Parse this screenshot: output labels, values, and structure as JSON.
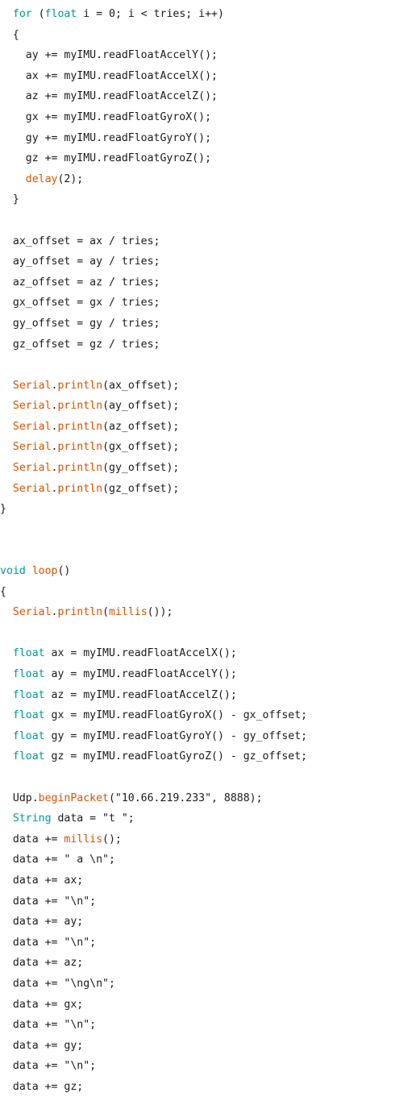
{
  "colors": {
    "background": "#ffffff",
    "text": "#1b1b1b",
    "keyword": "#00979c",
    "function": "#d35400"
  },
  "code": {
    "language": "Arduino C++",
    "lines": [
      [
        {
          "t": "  "
        },
        {
          "t": "for",
          "c": "kw"
        },
        {
          "t": " ("
        },
        {
          "t": "float",
          "c": "kw"
        },
        {
          "t": " i = 0; i < tries; i++)"
        }
      ],
      [
        {
          "t": "  {"
        }
      ],
      [
        {
          "t": "    ay += myIMU.readFloatAccelY();"
        }
      ],
      [
        {
          "t": "    ax += myIMU.readFloatAccelX();"
        }
      ],
      [
        {
          "t": "    az += myIMU.readFloatAccelZ();"
        }
      ],
      [
        {
          "t": "    gx += myIMU.readFloatGyroX();"
        }
      ],
      [
        {
          "t": "    gy += myIMU.readFloatGyroY();"
        }
      ],
      [
        {
          "t": "    gz += myIMU.readFloatGyroZ();"
        }
      ],
      [
        {
          "t": "    "
        },
        {
          "t": "delay",
          "c": "fn"
        },
        {
          "t": "(2);"
        }
      ],
      [
        {
          "t": "  }"
        }
      ],
      [
        {
          "t": ""
        }
      ],
      [
        {
          "t": "  ax_offset = ax / tries;"
        }
      ],
      [
        {
          "t": "  ay_offset = ay / tries;"
        }
      ],
      [
        {
          "t": "  az_offset = az / tries;"
        }
      ],
      [
        {
          "t": "  gx_offset = gx / tries;"
        }
      ],
      [
        {
          "t": "  gy_offset = gy / tries;"
        }
      ],
      [
        {
          "t": "  gz_offset = gz / tries;"
        }
      ],
      [
        {
          "t": ""
        }
      ],
      [
        {
          "t": "  "
        },
        {
          "t": "Serial",
          "c": "fn"
        },
        {
          "t": "."
        },
        {
          "t": "println",
          "c": "fn"
        },
        {
          "t": "(ax_offset);"
        }
      ],
      [
        {
          "t": "  "
        },
        {
          "t": "Serial",
          "c": "fn"
        },
        {
          "t": "."
        },
        {
          "t": "println",
          "c": "fn"
        },
        {
          "t": "(ay_offset);"
        }
      ],
      [
        {
          "t": "  "
        },
        {
          "t": "Serial",
          "c": "fn"
        },
        {
          "t": "."
        },
        {
          "t": "println",
          "c": "fn"
        },
        {
          "t": "(az_offset);"
        }
      ],
      [
        {
          "t": "  "
        },
        {
          "t": "Serial",
          "c": "fn"
        },
        {
          "t": "."
        },
        {
          "t": "println",
          "c": "fn"
        },
        {
          "t": "(gx_offset);"
        }
      ],
      [
        {
          "t": "  "
        },
        {
          "t": "Serial",
          "c": "fn"
        },
        {
          "t": "."
        },
        {
          "t": "println",
          "c": "fn"
        },
        {
          "t": "(gy_offset);"
        }
      ],
      [
        {
          "t": "  "
        },
        {
          "t": "Serial",
          "c": "fn"
        },
        {
          "t": "."
        },
        {
          "t": "println",
          "c": "fn"
        },
        {
          "t": "(gz_offset);"
        }
      ],
      [
        {
          "t": "}"
        }
      ],
      [
        {
          "t": ""
        }
      ],
      [
        {
          "t": ""
        }
      ],
      [
        {
          "t": "void",
          "c": "kw"
        },
        {
          "t": " "
        },
        {
          "t": "loop",
          "c": "fn"
        },
        {
          "t": "()"
        }
      ],
      [
        {
          "t": "{"
        }
      ],
      [
        {
          "t": "  "
        },
        {
          "t": "Serial",
          "c": "fn"
        },
        {
          "t": "."
        },
        {
          "t": "println",
          "c": "fn"
        },
        {
          "t": "("
        },
        {
          "t": "millis",
          "c": "fn"
        },
        {
          "t": "());"
        }
      ],
      [
        {
          "t": ""
        }
      ],
      [
        {
          "t": "  "
        },
        {
          "t": "float",
          "c": "kw"
        },
        {
          "t": " ax = myIMU.readFloatAccelX();"
        }
      ],
      [
        {
          "t": "  "
        },
        {
          "t": "float",
          "c": "kw"
        },
        {
          "t": " ay = myIMU.readFloatAccelY();"
        }
      ],
      [
        {
          "t": "  "
        },
        {
          "t": "float",
          "c": "kw"
        },
        {
          "t": " az = myIMU.readFloatAccelZ();"
        }
      ],
      [
        {
          "t": "  "
        },
        {
          "t": "float",
          "c": "kw"
        },
        {
          "t": " gx = myIMU.readFloatGyroX() - gx_offset;"
        }
      ],
      [
        {
          "t": "  "
        },
        {
          "t": "float",
          "c": "kw"
        },
        {
          "t": " gy = myIMU.readFloatGyroY() - gy_offset;"
        }
      ],
      [
        {
          "t": "  "
        },
        {
          "t": "float",
          "c": "kw"
        },
        {
          "t": " gz = myIMU.readFloatGyroZ() - gz_offset;"
        }
      ],
      [
        {
          "t": ""
        }
      ],
      [
        {
          "t": "  Udp."
        },
        {
          "t": "beginPacket",
          "c": "fn"
        },
        {
          "t": "(\"10.66.219.233\", 8888);"
        }
      ],
      [
        {
          "t": "  "
        },
        {
          "t": "String",
          "c": "kw"
        },
        {
          "t": " data = \"t \";"
        }
      ],
      [
        {
          "t": "  data += "
        },
        {
          "t": "millis",
          "c": "fn"
        },
        {
          "t": "();"
        }
      ],
      [
        {
          "t": "  data += \" a \\n\";"
        }
      ],
      [
        {
          "t": "  data += ax;"
        }
      ],
      [
        {
          "t": "  data += \"\\n\";"
        }
      ],
      [
        {
          "t": "  data += ay;"
        }
      ],
      [
        {
          "t": "  data += \"\\n\";"
        }
      ],
      [
        {
          "t": "  data += az;"
        }
      ],
      [
        {
          "t": "  data += \"\\ng\\n\";"
        }
      ],
      [
        {
          "t": "  data += gx;"
        }
      ],
      [
        {
          "t": "  data += \"\\n\";"
        }
      ],
      [
        {
          "t": "  data += gy;"
        }
      ],
      [
        {
          "t": "  data += \"\\n\";"
        }
      ],
      [
        {
          "t": "  data += gz;"
        }
      ]
    ]
  }
}
